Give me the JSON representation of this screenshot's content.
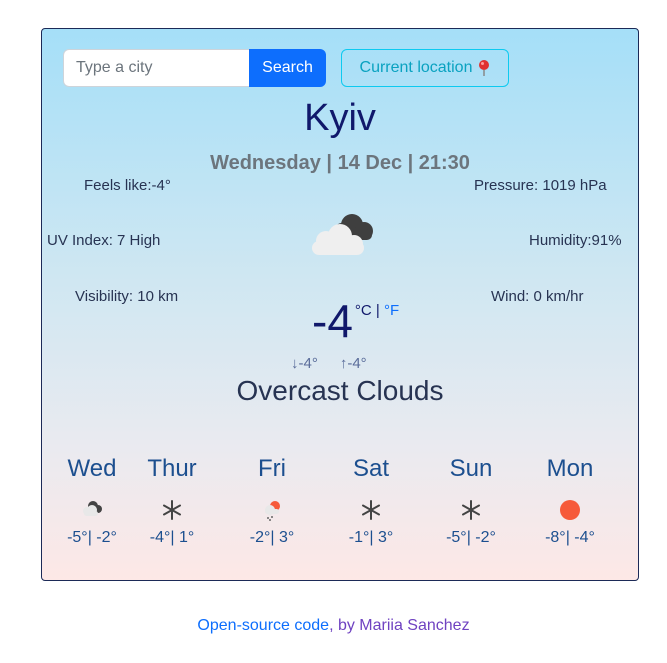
{
  "search": {
    "placeholder": "Type a city",
    "button_label": "Search",
    "location_label": "Current location",
    "location_icon": "pin-icon"
  },
  "current": {
    "city": "Kyiv",
    "date": "Wednesday | 14 Dec | 21:30",
    "feels_like": "Feels like:-4°",
    "pressure": "Pressure: 1019 hPa",
    "uv_index": "UV Index: 7 High",
    "humidity": "Humidity:91%",
    "visibility": "Visibility: 10 km",
    "wind": "Wind: 0 km/hr",
    "icon": "overcast-clouds-icon",
    "temperature": "-4",
    "unit_c": "°C",
    "unit_sep": " | ",
    "unit_f": "°F",
    "min": "↓-4°",
    "max": "↑-4°",
    "description": "Overcast Clouds"
  },
  "forecast": [
    {
      "day": "Wed",
      "icon": "broken-clouds-icon",
      "temps": "-5°| -2°"
    },
    {
      "day": "Thur",
      "icon": "snow-icon",
      "temps": "-4°| 1°"
    },
    {
      "day": "Fri",
      "icon": "snow-sun-icon",
      "temps": "-2°| 3°"
    },
    {
      "day": "Sat",
      "icon": "snow-icon",
      "temps": "-1°| 3°"
    },
    {
      "day": "Sun",
      "icon": "snow-icon",
      "temps": "-5°| -2°"
    },
    {
      "day": "Mon",
      "icon": "sun-icon",
      "temps": "-8°| -4°"
    }
  ],
  "footer": {
    "source_link": "Open-source code",
    "by_text": ", by Mariia Sanchez"
  },
  "colors": {
    "accent": "#0d6efd",
    "city": "#10186b",
    "forecast": "#1c4f8f",
    "sun": "#f65a3a"
  }
}
